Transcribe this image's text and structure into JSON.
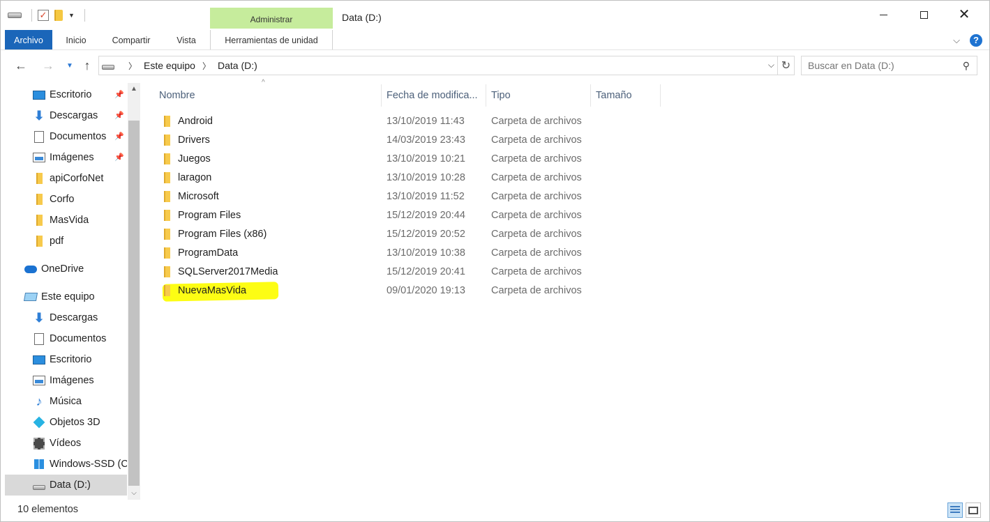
{
  "window": {
    "title": "Data (D:)",
    "context_tab": "Administrar"
  },
  "ribbon": {
    "tabs": [
      "Archivo",
      "Inicio",
      "Compartir",
      "Vista",
      "Herramientas de unidad"
    ]
  },
  "address": {
    "crumbs": [
      "Este equipo",
      "Data (D:)"
    ]
  },
  "search": {
    "placeholder": "Buscar en Data (D:)"
  },
  "sidebar": {
    "items": [
      {
        "label": "Escritorio",
        "icon": "desktop-icon",
        "pinned": true
      },
      {
        "label": "Descargas",
        "icon": "download-icon",
        "pinned": true
      },
      {
        "label": "Documentos",
        "icon": "document-icon",
        "pinned": true
      },
      {
        "label": "Imágenes",
        "icon": "pictures-icon",
        "pinned": true
      },
      {
        "label": "apiCorfoNet",
        "icon": "folder-icon",
        "pinned": false
      },
      {
        "label": "Corfo",
        "icon": "folder-icon",
        "pinned": false
      },
      {
        "label": "MasVida",
        "icon": "folder-icon",
        "pinned": false
      },
      {
        "label": "pdf",
        "icon": "folder-icon",
        "pinned": false
      },
      {
        "label": "OneDrive",
        "icon": "onedrive-icon",
        "pinned": false
      },
      {
        "label": "Este equipo",
        "icon": "this-pc-icon",
        "pinned": false
      },
      {
        "label": "Descargas",
        "icon": "download-icon",
        "pinned": false
      },
      {
        "label": "Documentos",
        "icon": "document-icon",
        "pinned": false
      },
      {
        "label": "Escritorio",
        "icon": "desktop-icon",
        "pinned": false
      },
      {
        "label": "Imágenes",
        "icon": "pictures-icon",
        "pinned": false
      },
      {
        "label": "Música",
        "icon": "music-icon",
        "pinned": false
      },
      {
        "label": "Objetos 3D",
        "icon": "objects-3d-icon",
        "pinned": false
      },
      {
        "label": "Vídeos",
        "icon": "videos-icon",
        "pinned": false
      },
      {
        "label": "Windows-SSD (C",
        "icon": "windows-drive-icon",
        "pinned": false
      },
      {
        "label": "Data (D:)",
        "icon": "drive-icon",
        "pinned": false,
        "selected": true
      }
    ]
  },
  "columns": {
    "name": "Nombre",
    "date": "Fecha de modifica...",
    "type": "Tipo",
    "size": "Tamaño"
  },
  "files": [
    {
      "name": "Android",
      "date": "13/10/2019 11:43",
      "type": "Carpeta de archivos"
    },
    {
      "name": "Drivers",
      "date": "14/03/2019 23:43",
      "type": "Carpeta de archivos"
    },
    {
      "name": "Juegos",
      "date": "13/10/2019 10:21",
      "type": "Carpeta de archivos"
    },
    {
      "name": "laragon",
      "date": "13/10/2019 10:28",
      "type": "Carpeta de archivos"
    },
    {
      "name": "Microsoft",
      "date": "13/10/2019 11:52",
      "type": "Carpeta de archivos"
    },
    {
      "name": "Program Files",
      "date": "15/12/2019 20:44",
      "type": "Carpeta de archivos"
    },
    {
      "name": "Program Files (x86)",
      "date": "15/12/2019 20:52",
      "type": "Carpeta de archivos"
    },
    {
      "name": "ProgramData",
      "date": "13/10/2019 10:38",
      "type": "Carpeta de archivos"
    },
    {
      "name": "SQLServer2017Media",
      "date": "15/12/2019 20:41",
      "type": "Carpeta de archivos"
    },
    {
      "name": "NuevaMasVida",
      "date": "09/01/2020 19:13",
      "type": "Carpeta de archivos",
      "highlighted": true
    }
  ],
  "status": {
    "count": "10 elementos"
  },
  "colors": {
    "archivo_tab": "#1b66b9",
    "context_tab": "#c6ec9c",
    "highlight": "#fdfd14",
    "folder": "#f7ca4c"
  }
}
